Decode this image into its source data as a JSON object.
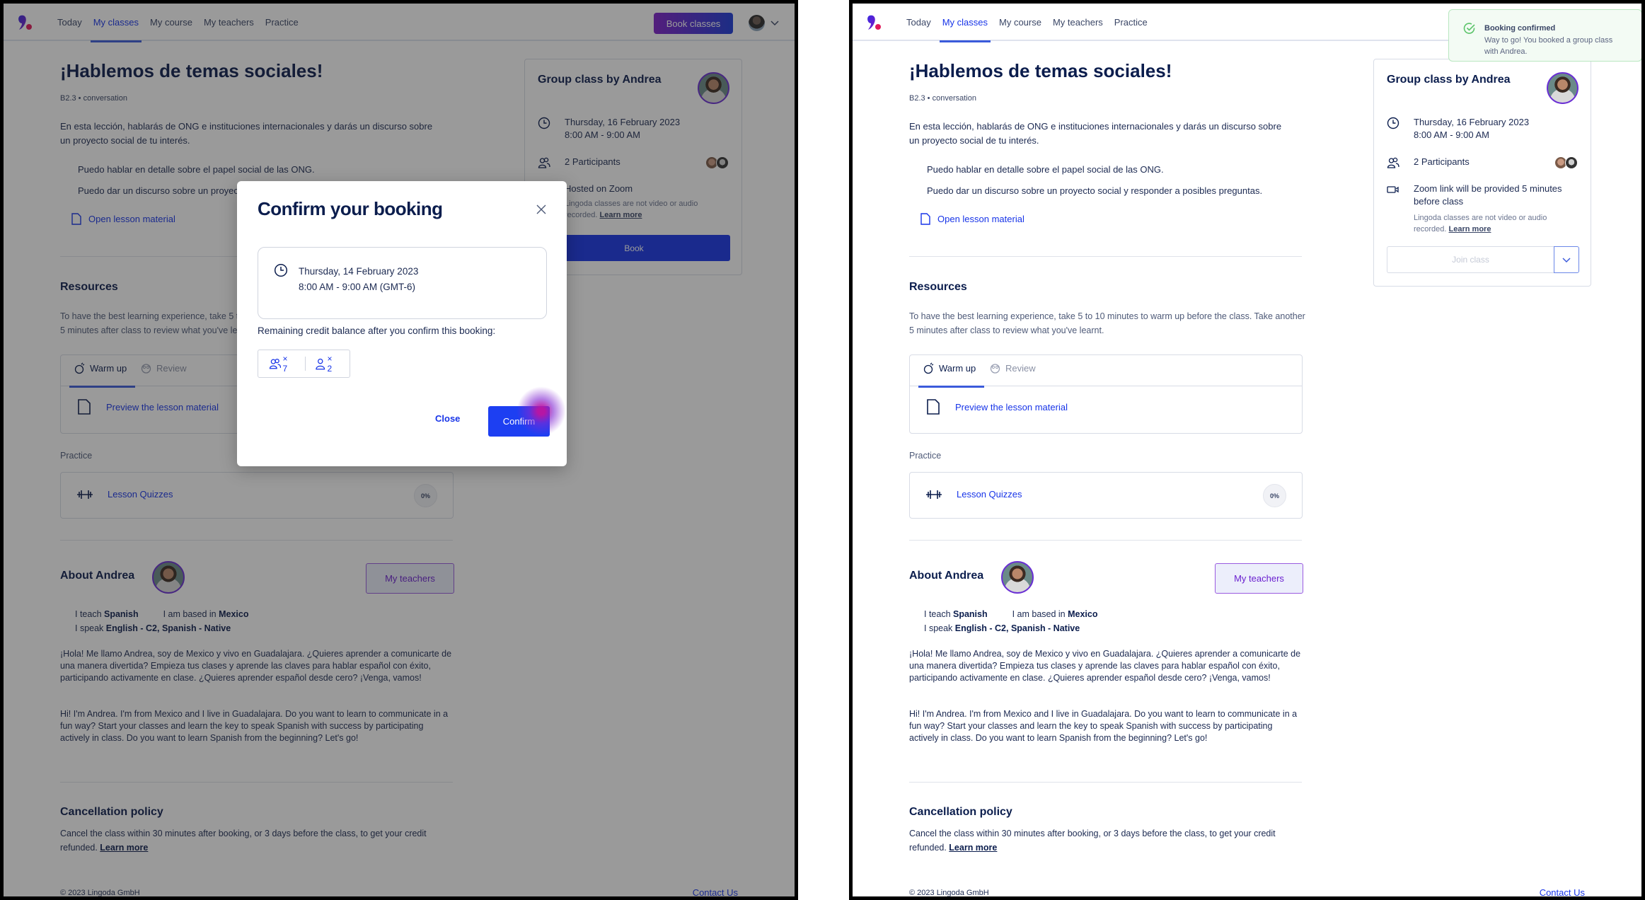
{
  "colors": {
    "brand_blue": "#1734e8",
    "text_navy": "#0b1d4d",
    "success_green": "#5cc46a",
    "gradient_start": "#7e1ec9",
    "gradient_end": "#1a3ad8"
  },
  "nav": {
    "items": [
      {
        "label": "Today",
        "active": false
      },
      {
        "label": "My classes",
        "active": true
      },
      {
        "label": "My course",
        "active": false
      },
      {
        "label": "My teachers",
        "active": false
      },
      {
        "label": "Practice",
        "active": false
      }
    ],
    "book_classes_label": "Book classes",
    "user_menu_icon": "chevron-down-icon"
  },
  "lesson": {
    "title": "¡Hablemos de temas sociales!",
    "level": "B2.3 • conversation",
    "description": "En esta lección, hablarás de ONG e instituciones internacionales y darás un discurso sobre un proyecto social de tu interés.",
    "goals": [
      "Puedo hablar en detalle sobre el papel social de las ONG.",
      "Puedo dar un discurso sobre un proyecto social y responder a posibles preguntas."
    ],
    "open_material_label": "Open lesson material"
  },
  "resources": {
    "title": "Resources",
    "intro": "To have the best learning experience, take 5 to 10 minutes to warm up before the class. Take another 5 minutes after class to review what you've learnt.",
    "tabs": [
      {
        "label": "Warm up",
        "icon": "warm-up-icon",
        "active": true
      },
      {
        "label": "Review",
        "icon": "review-icon",
        "active": false
      }
    ],
    "preview_label": "Preview the lesson material",
    "practice_label": "Practice",
    "quiz_label": "Lesson Quizzes",
    "quiz_progress": "0%"
  },
  "teacher": {
    "about_title": "About Andrea",
    "my_teachers_label": "My teachers",
    "teach_prefix": "I teach ",
    "teach_value": "Spanish",
    "based_prefix": "I am based in ",
    "based_value": "Mexico",
    "speak_prefix": "I speak ",
    "speak_value": "English - C2, Spanish - Native",
    "bio_es": "¡Hola! Me llamo Andrea, soy de Mexico y vivo en Guadalajara. ¿Quieres aprender a comunicarte de una manera divertida? Empieza tus clases y aprende las claves para hablar español con éxito, participando activamente en clase. ¿Quieres aprender español desde cero? ¡Venga, vamos!",
    "bio_en": "Hi! I'm Andrea. I'm from Mexico and I live in Guadalajara. Do you want to learn to communicate in a fun way? Start your classes and learn the key to speak Spanish with success by participating actively in class. Do you want to learn Spanish from the beginning? Let's go!"
  },
  "cancellation": {
    "title": "Cancellation policy",
    "text": "Cancel the class within 30 minutes after booking, or 3 days before the class, to get your credit refunded. ",
    "learn_more": "Learn more"
  },
  "footer": {
    "copyright": "© 2023 Lingoda GmbH",
    "contact": "Contact Us"
  },
  "class_card": {
    "title": "Group class by Andrea",
    "date": "Thursday, 16 February 2023",
    "time": "8:00 AM - 9:00 AM",
    "participants": "2 Participants",
    "hosted_before": "Hosted on Zoom",
    "zoom_after": "Zoom link will be provided 5 minutes before class",
    "note": "Lingoda classes are not video or audio recorded. ",
    "note_link": "Learn more",
    "book_label": "Book",
    "join_label": "Join class"
  },
  "modal": {
    "title": "Confirm your booking",
    "date": "Thursday, 14 February 2023",
    "time": "8:00 AM - 9:00 AM (GMT-6)",
    "remaining_label": "Remaining credit balance after you confirm this booking:",
    "credits": [
      {
        "icon": "group-credits-icon",
        "value": "× 7"
      },
      {
        "icon": "private-credits-icon",
        "value": "× 2"
      }
    ],
    "close_label": "Close",
    "confirm_label": "Confirm"
  },
  "toast": {
    "title": "Booking confirmed",
    "body": "Way to go! You booked a group class with Andrea."
  }
}
